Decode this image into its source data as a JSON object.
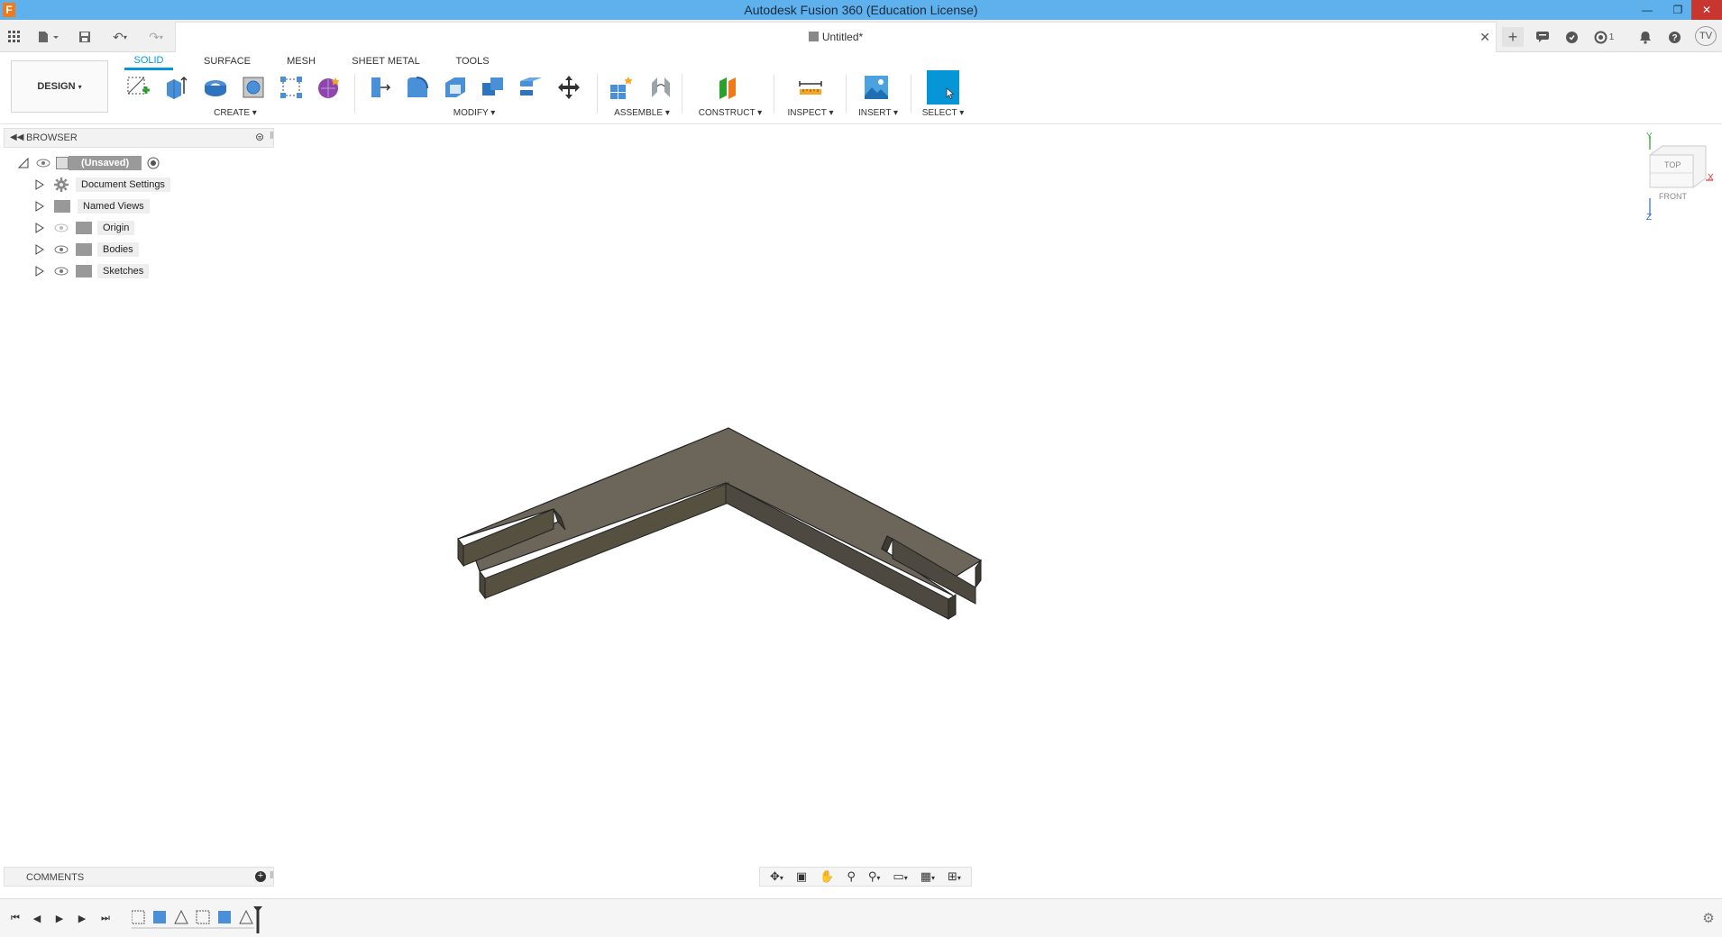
{
  "window": {
    "app_logo": "F",
    "title": "Autodesk Fusion 360 (Education License)",
    "controls": [
      "minimize",
      "restore",
      "close"
    ]
  },
  "qat": {
    "document_tab": "Untitled*",
    "job_status_count": "1",
    "user_initials": "TV"
  },
  "ribbon": {
    "workspace": "DESIGN",
    "tabs": [
      "SOLID",
      "SURFACE",
      "MESH",
      "SHEET METAL",
      "TOOLS"
    ],
    "active_tab": "SOLID",
    "groups": {
      "create": "CREATE",
      "modify": "MODIFY",
      "assemble": "ASSEMBLE",
      "construct": "CONSTRUCT",
      "inspect": "INSPECT",
      "insert": "INSERT",
      "select": "SELECT"
    },
    "accent": "#0696d7"
  },
  "browser": {
    "title": "BROWSER",
    "root": "(Unsaved)",
    "items": [
      {
        "label": "Document Settings",
        "icon": "gear-icon"
      },
      {
        "label": "Named Views",
        "icon": "folder-icon"
      },
      {
        "label": "Origin",
        "icon": "folder-icon"
      },
      {
        "label": "Bodies",
        "icon": "folder-icon"
      },
      {
        "label": "Sketches",
        "icon": "folder-icon"
      }
    ]
  },
  "comments": {
    "title": "COMMENTS"
  },
  "viewcube": {
    "top": "TOP",
    "front": "FRONT",
    "axis_y": "Y",
    "axis_x": "X",
    "axis_z": "Z"
  },
  "model": {
    "body_color": "#6b655a"
  }
}
